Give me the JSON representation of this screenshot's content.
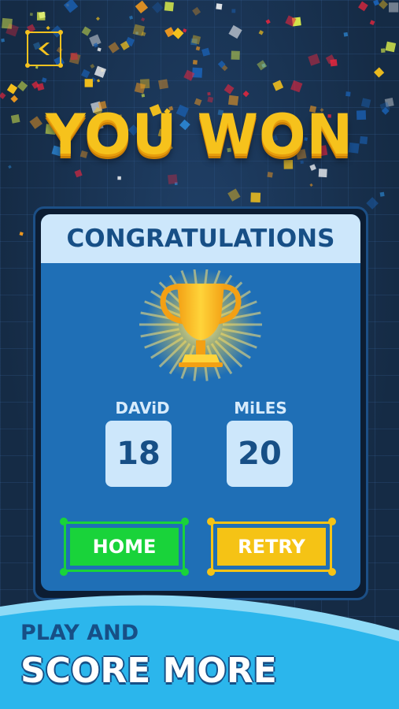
{
  "screen": {
    "title": "YOU WON",
    "back_icon": "chevron-left-icon"
  },
  "card": {
    "header": "CONGRATULATIONS",
    "trophy_icon": "trophy-icon",
    "players": [
      {
        "name": "DAViD",
        "score": "18"
      },
      {
        "name": "MiLES",
        "score": "20"
      }
    ],
    "buttons": {
      "home_label": "HOME",
      "retry_label": "RETRY"
    }
  },
  "promo": {
    "line1": "PLAY AND",
    "line2": "SCORE MORE"
  },
  "colors": {
    "background": "#152a44",
    "title": "#f6c21c",
    "card": "#1f6fb6",
    "header": "#cde7fb",
    "home": "#19d33a",
    "retry": "#f5c315",
    "banner": "#2bb6ec"
  }
}
